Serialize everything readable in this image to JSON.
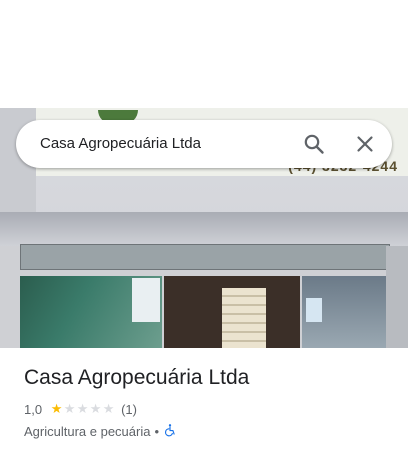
{
  "search": {
    "query": "Casa Agropecuária Ltda"
  },
  "place": {
    "name": "Casa Agropecuária Ltda",
    "rating_text": "1,0",
    "rating_value": 1,
    "rating_max": 5,
    "review_count": "(1)",
    "category": "Agricultura e pecuária",
    "separator": "•"
  },
  "photo": {
    "sign_phone": "(44) 3232-4244"
  },
  "colors": {
    "star_filled": "#fbbc04",
    "star_empty": "#dadce0",
    "accent": "#1a73e8"
  },
  "icons": {
    "search": "search-icon",
    "close": "close-icon",
    "accessibility": "wheelchair-accessible-icon"
  }
}
